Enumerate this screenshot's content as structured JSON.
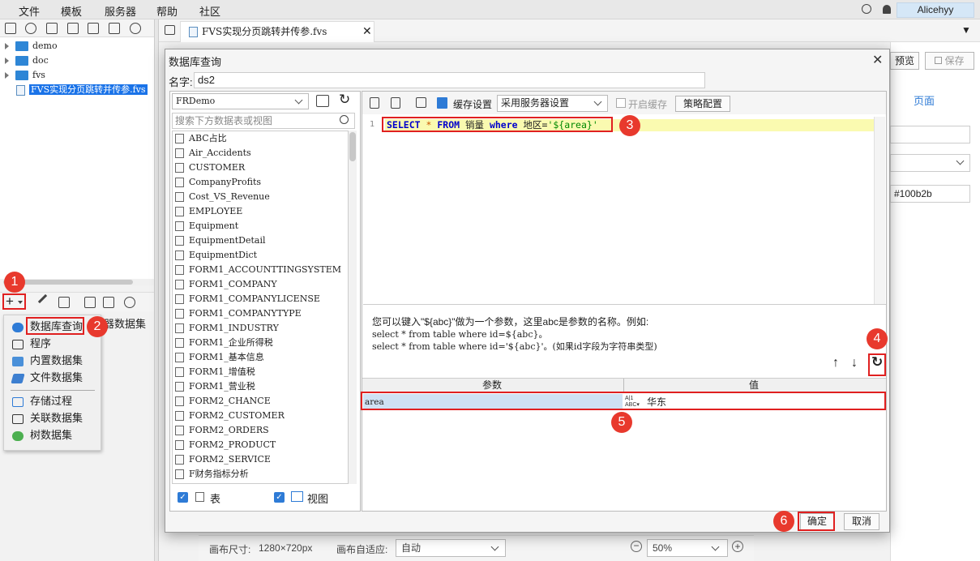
{
  "menu": [
    "文件",
    "模板",
    "服务器",
    "帮助",
    "社区"
  ],
  "user": "Alicehyy",
  "tree": [
    {
      "label": "demo",
      "type": "folder"
    },
    {
      "label": "doc",
      "type": "folder"
    },
    {
      "label": "fvs",
      "type": "folder"
    },
    {
      "label": "FVS实现分页跳转并传参.fvs",
      "type": "file"
    }
  ],
  "file_tab": "FVS实现分页跳转并传参.fvs",
  "dataset_menu": {
    "items": [
      "数据库查询",
      "程序",
      "内置数据集",
      "文件数据集",
      "存储过程",
      "关联数据集",
      "树数据集"
    ],
    "behind_label": "器数据集"
  },
  "right_panel": {
    "preview": "预览",
    "save": "保存",
    "page": "页面",
    "color": "#100b2b"
  },
  "bottom": {
    "canvas_size_label": "画布尺寸:",
    "canvas_size": "1280×720px",
    "adapt_label": "画布自适应:",
    "adapt_value": "自动",
    "zoom": "50%"
  },
  "dialog": {
    "title": "数据库查询",
    "name_label": "名字:",
    "name_value": "ds2",
    "connection": "FRDemo",
    "search_placeholder": "搜索下方数据表或视图",
    "tables": [
      "ABC占比",
      "Air_Accidents",
      "CUSTOMER",
      "CompanyProfits",
      "Cost_VS_Revenue",
      "EMPLOYEE",
      "Equipment",
      "EquipmentDetail",
      "EquipmentDict",
      "FORM1_ACCOUNTTINGSYSTEM",
      "FORM1_COMPANY",
      "FORM1_COMPANYLICENSE",
      "FORM1_COMPANYTYPE",
      "FORM1_INDUSTRY",
      "FORM1_企业所得税",
      "FORM1_基本信息",
      "FORM1_增值税",
      "FORM1_营业税",
      "FORM2_CHANCE",
      "FORM2_CUSTOMER",
      "FORM2_ORDERS",
      "FORM2_PRODUCT",
      "FORM2_SERVICE",
      "F财务指标分析"
    ],
    "check_table": "表",
    "check_view": "视图",
    "cache_setting": "缓存设置",
    "cache_select": "采用服务器设置",
    "enable_cache": "开启缓存",
    "strategy": "策略配置",
    "sql_line_no": "1",
    "sql": {
      "kw1": "SELECT",
      "star": "*",
      "kw2": "FROM",
      "table": "销量",
      "kw3": "where",
      "cond": "地区=",
      "str": "'${area}'"
    },
    "hint_lines": [
      "您可以键入\"${abc}\"做为一个参数，这里abc是参数的名称。例如:",
      "select * from table where id=${abc}。",
      "select * from table where id='${abc}'。(如果id字段为字符串类型)"
    ],
    "param_col": "参数",
    "value_col": "值",
    "param_name": "area",
    "param_value": "华东",
    "ok": "确定",
    "cancel": "取消"
  },
  "badges": [
    "1",
    "2",
    "3",
    "4",
    "5",
    "6"
  ],
  "colors": {
    "accent": "#e8392d",
    "selection": "#cfe1f3",
    "keyword": "#0000cc"
  }
}
